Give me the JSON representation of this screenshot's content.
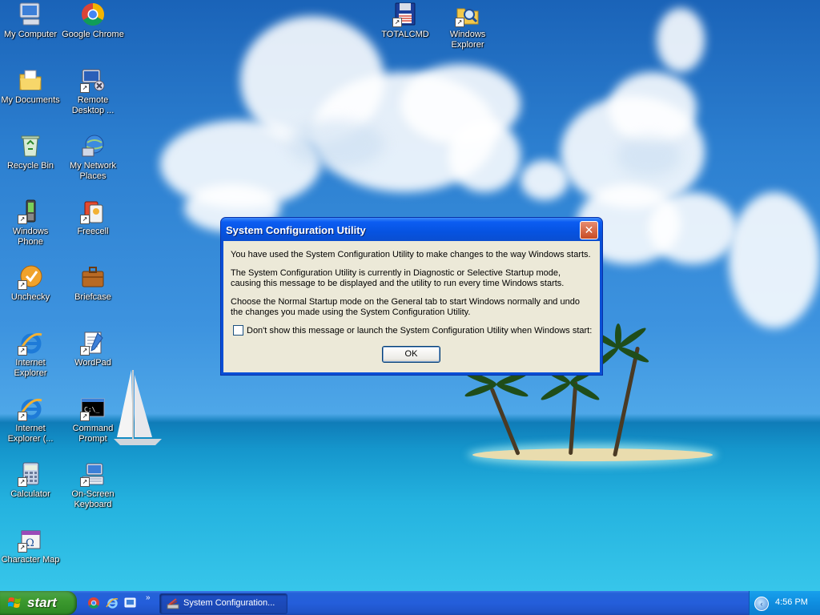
{
  "desktop_icons": [
    {
      "id": "my-computer",
      "label": "My Computer",
      "icon": "computer-icon"
    },
    {
      "id": "google-chrome",
      "label": "Google Chrome",
      "icon": "chrome-icon"
    },
    {
      "id": "my-documents",
      "label": "My Documents",
      "icon": "folder-documents-icon"
    },
    {
      "id": "remote-desktop",
      "label": "Remote Desktop ...",
      "icon": "remote-desktop-icon"
    },
    {
      "id": "recycle-bin",
      "label": "Recycle Bin",
      "icon": "recycle-bin-icon"
    },
    {
      "id": "my-network-places",
      "label": "My Network Places",
      "icon": "network-places-icon"
    },
    {
      "id": "windows-phone",
      "label": "Windows Phone",
      "icon": "phone-icon"
    },
    {
      "id": "freecell",
      "label": "Freecell",
      "icon": "cards-icon"
    },
    {
      "id": "unchecky",
      "label": "Unchecky",
      "icon": "unchecky-icon"
    },
    {
      "id": "briefcase",
      "label": "Briefcase",
      "icon": "briefcase-icon"
    },
    {
      "id": "internet-explorer",
      "label": "Internet Explorer",
      "icon": "ie-icon"
    },
    {
      "id": "wordpad",
      "label": "WordPad",
      "icon": "wordpad-icon"
    },
    {
      "id": "internet-explorer-2",
      "label": "Internet Explorer (...",
      "icon": "ie-icon"
    },
    {
      "id": "command-prompt",
      "label": "Command Prompt",
      "icon": "command-prompt-icon"
    },
    {
      "id": "calculator",
      "label": "Calculator",
      "icon": "calculator-icon"
    },
    {
      "id": "on-screen-keyboard",
      "label": "On-Screen Keyboard",
      "icon": "keyboard-icon"
    },
    {
      "id": "character-map",
      "label": "Character Map",
      "icon": "character-map-icon"
    },
    {
      "id": "totalcmd",
      "label": "TOTALCMD",
      "icon": "floppy-icon"
    },
    {
      "id": "windows-explorer",
      "label": "Windows Explorer",
      "icon": "explorer-icon"
    }
  ],
  "dialog": {
    "title": "System Configuration Utility",
    "close_label": "✕",
    "paragraphs": [
      "You have used the System Configuration Utility to make changes to the way Windows starts.",
      "The System Configuration Utility is currently in Diagnostic or Selective Startup mode, causing this message to be displayed and the utility to run every time Windows starts.",
      "Choose the Normal Startup mode on the General tab to start Windows normally and undo the changes you made using the System Configuration Utility."
    ],
    "checkbox_label": "Don't show this message or launch the System Configuration Utility when Windows start:",
    "checkbox_checked": false,
    "ok_label": "OK"
  },
  "taskbar": {
    "start_label": "start",
    "quick_launch": [
      "chrome-icon",
      "ie-icon",
      "show-desktop-icon"
    ],
    "chevron": "»",
    "task_button_label": "System Configuration...",
    "tray_toggle": "‹",
    "clock": "4:56 PM"
  }
}
